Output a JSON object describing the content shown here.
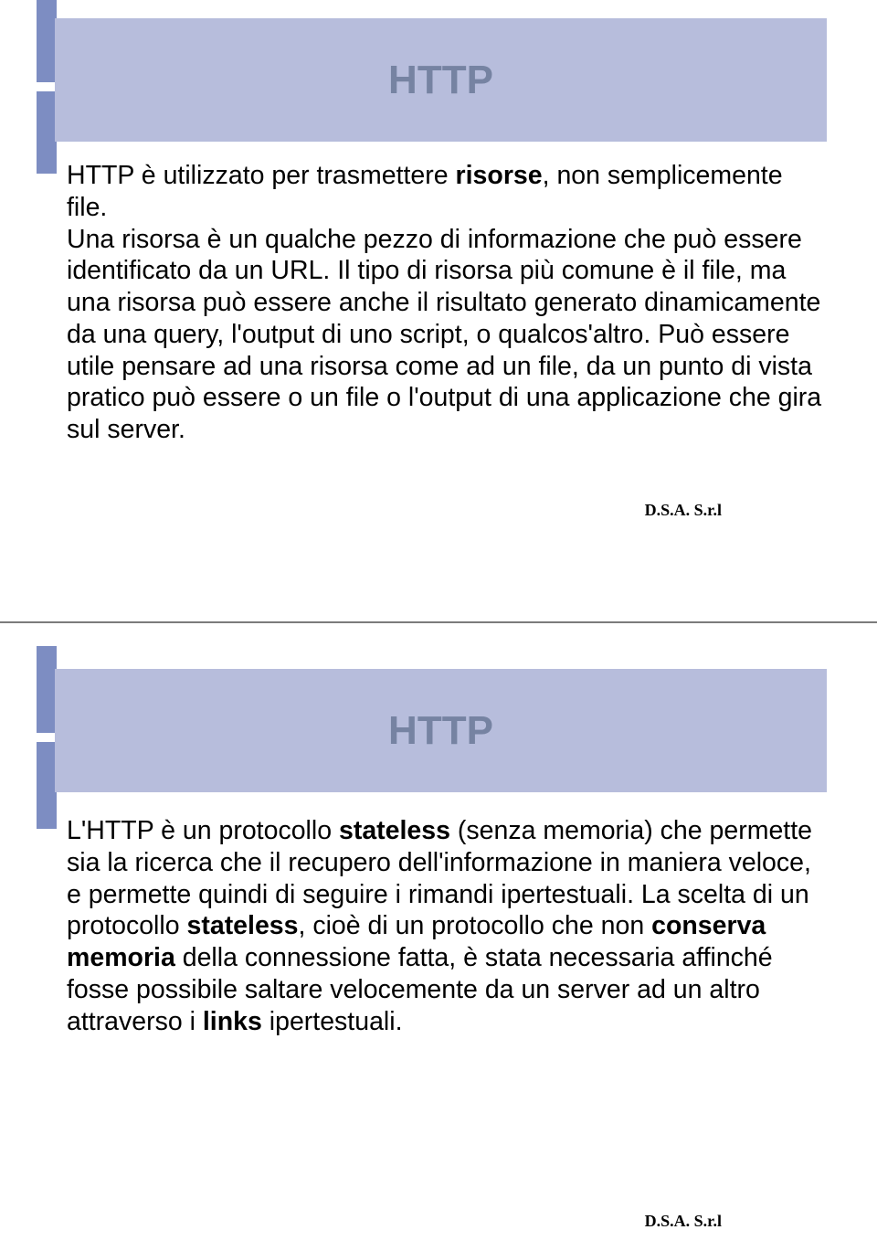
{
  "slide1": {
    "title": "HTTP",
    "paragraph_html": "HTTP è utilizzato per trasmettere <b>risorse</b>, non semplicemente file.<br>Una risorsa è un qualche pezzo di informazione che può essere identificato da un URL. Il tipo di risorsa più comune è il file, ma una risorsa può essere anche il risultato generato dinamicamente da una query, l'output di uno script, o qualcos'altro. Può essere utile pensare ad una risorsa come ad un file, da un punto di vista pratico può essere o un file o l'output di una applicazione che gira sul server.",
    "footer": "D.S.A. S.r.l"
  },
  "slide2": {
    "title": "HTTP",
    "paragraph_html": "L'HTTP è un protocollo <b>stateless</b> (senza memoria) che permette sia la ricerca che il recupero dell'informazione in maniera veloce, e permette quindi di seguire i rimandi ipertestuali. La scelta di un protocollo <b>stateless</b>, cioè di un protocollo che non <b>conserva memoria</b> della connessione fatta, è stata necessaria affinché fosse possibile saltare velocemente da un server ad un altro attraverso i <b>links</b> ipertestuali.",
    "footer": "D.S.A. S.r.l"
  }
}
